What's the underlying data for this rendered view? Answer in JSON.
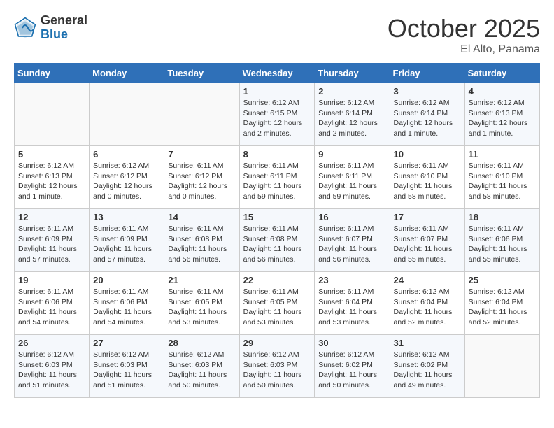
{
  "header": {
    "logo_general": "General",
    "logo_blue": "Blue",
    "month": "October 2025",
    "location": "El Alto, Panama"
  },
  "weekdays": [
    "Sunday",
    "Monday",
    "Tuesday",
    "Wednesday",
    "Thursday",
    "Friday",
    "Saturday"
  ],
  "weeks": [
    [
      {
        "day": "",
        "info": ""
      },
      {
        "day": "",
        "info": ""
      },
      {
        "day": "",
        "info": ""
      },
      {
        "day": "1",
        "info": "Sunrise: 6:12 AM\nSunset: 6:15 PM\nDaylight: 12 hours\nand 2 minutes."
      },
      {
        "day": "2",
        "info": "Sunrise: 6:12 AM\nSunset: 6:14 PM\nDaylight: 12 hours\nand 2 minutes."
      },
      {
        "day": "3",
        "info": "Sunrise: 6:12 AM\nSunset: 6:14 PM\nDaylight: 12 hours\nand 1 minute."
      },
      {
        "day": "4",
        "info": "Sunrise: 6:12 AM\nSunset: 6:13 PM\nDaylight: 12 hours\nand 1 minute."
      }
    ],
    [
      {
        "day": "5",
        "info": "Sunrise: 6:12 AM\nSunset: 6:13 PM\nDaylight: 12 hours\nand 1 minute."
      },
      {
        "day": "6",
        "info": "Sunrise: 6:12 AM\nSunset: 6:12 PM\nDaylight: 12 hours\nand 0 minutes."
      },
      {
        "day": "7",
        "info": "Sunrise: 6:11 AM\nSunset: 6:12 PM\nDaylight: 12 hours\nand 0 minutes."
      },
      {
        "day": "8",
        "info": "Sunrise: 6:11 AM\nSunset: 6:11 PM\nDaylight: 11 hours\nand 59 minutes."
      },
      {
        "day": "9",
        "info": "Sunrise: 6:11 AM\nSunset: 6:11 PM\nDaylight: 11 hours\nand 59 minutes."
      },
      {
        "day": "10",
        "info": "Sunrise: 6:11 AM\nSunset: 6:10 PM\nDaylight: 11 hours\nand 58 minutes."
      },
      {
        "day": "11",
        "info": "Sunrise: 6:11 AM\nSunset: 6:10 PM\nDaylight: 11 hours\nand 58 minutes."
      }
    ],
    [
      {
        "day": "12",
        "info": "Sunrise: 6:11 AM\nSunset: 6:09 PM\nDaylight: 11 hours\nand 57 minutes."
      },
      {
        "day": "13",
        "info": "Sunrise: 6:11 AM\nSunset: 6:09 PM\nDaylight: 11 hours\nand 57 minutes."
      },
      {
        "day": "14",
        "info": "Sunrise: 6:11 AM\nSunset: 6:08 PM\nDaylight: 11 hours\nand 56 minutes."
      },
      {
        "day": "15",
        "info": "Sunrise: 6:11 AM\nSunset: 6:08 PM\nDaylight: 11 hours\nand 56 minutes."
      },
      {
        "day": "16",
        "info": "Sunrise: 6:11 AM\nSunset: 6:07 PM\nDaylight: 11 hours\nand 56 minutes."
      },
      {
        "day": "17",
        "info": "Sunrise: 6:11 AM\nSunset: 6:07 PM\nDaylight: 11 hours\nand 55 minutes."
      },
      {
        "day": "18",
        "info": "Sunrise: 6:11 AM\nSunset: 6:06 PM\nDaylight: 11 hours\nand 55 minutes."
      }
    ],
    [
      {
        "day": "19",
        "info": "Sunrise: 6:11 AM\nSunset: 6:06 PM\nDaylight: 11 hours\nand 54 minutes."
      },
      {
        "day": "20",
        "info": "Sunrise: 6:11 AM\nSunset: 6:06 PM\nDaylight: 11 hours\nand 54 minutes."
      },
      {
        "day": "21",
        "info": "Sunrise: 6:11 AM\nSunset: 6:05 PM\nDaylight: 11 hours\nand 53 minutes."
      },
      {
        "day": "22",
        "info": "Sunrise: 6:11 AM\nSunset: 6:05 PM\nDaylight: 11 hours\nand 53 minutes."
      },
      {
        "day": "23",
        "info": "Sunrise: 6:11 AM\nSunset: 6:04 PM\nDaylight: 11 hours\nand 53 minutes."
      },
      {
        "day": "24",
        "info": "Sunrise: 6:12 AM\nSunset: 6:04 PM\nDaylight: 11 hours\nand 52 minutes."
      },
      {
        "day": "25",
        "info": "Sunrise: 6:12 AM\nSunset: 6:04 PM\nDaylight: 11 hours\nand 52 minutes."
      }
    ],
    [
      {
        "day": "26",
        "info": "Sunrise: 6:12 AM\nSunset: 6:03 PM\nDaylight: 11 hours\nand 51 minutes."
      },
      {
        "day": "27",
        "info": "Sunrise: 6:12 AM\nSunset: 6:03 PM\nDaylight: 11 hours\nand 51 minutes."
      },
      {
        "day": "28",
        "info": "Sunrise: 6:12 AM\nSunset: 6:03 PM\nDaylight: 11 hours\nand 50 minutes."
      },
      {
        "day": "29",
        "info": "Sunrise: 6:12 AM\nSunset: 6:03 PM\nDaylight: 11 hours\nand 50 minutes."
      },
      {
        "day": "30",
        "info": "Sunrise: 6:12 AM\nSunset: 6:02 PM\nDaylight: 11 hours\nand 50 minutes."
      },
      {
        "day": "31",
        "info": "Sunrise: 6:12 AM\nSunset: 6:02 PM\nDaylight: 11 hours\nand 49 minutes."
      },
      {
        "day": "",
        "info": ""
      }
    ]
  ]
}
